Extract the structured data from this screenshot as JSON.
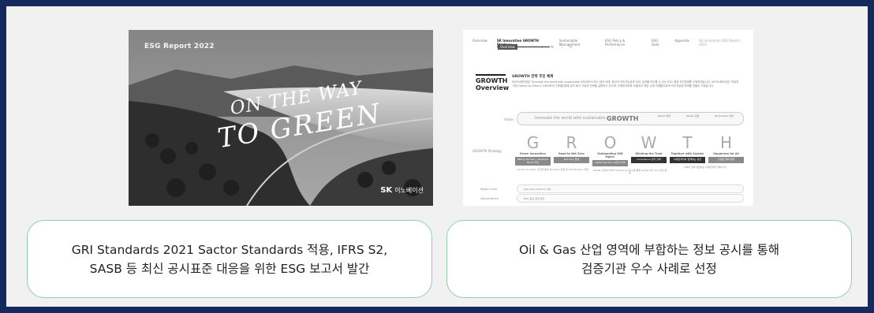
{
  "cover": {
    "label": "ESG Report 2022",
    "title_line1": "ON THE WAY",
    "title_line2": "TO GREEN",
    "logo_mark": "SK",
    "logo_corp": "이노베이션"
  },
  "page": {
    "nav": [
      "Overview",
      "SK Innovation GROWTH Strategy",
      "Sustainable Management",
      "ESG Policy & Performance",
      "ESG Data",
      "Appendix"
    ],
    "nav_right": "SK innovation ESG Report 2022",
    "subtabs": [
      "Overview",
      "G",
      "R",
      "O",
      "W",
      "T",
      "H"
    ],
    "title_line1": "GROWTH",
    "title_line2": "Overview",
    "heading": "GROWTH 전략 추진 체계",
    "description": "SK이노베이션은 'Innovate the world with sustainable GROWTH'라는 비전 아래, 회사의 지속가능성과 ESG 성과를 모두를 수 있는 ESG 경영 추진체계를 수립하였습니다. SK이노베이션은 '카본투 그린(Carbon to Green)' GROWTH 전략을 통해 우리 회사 고유의 전략을 실현하고 있으며, 이해관계자와 소통하고 책임 있게 이행함으로써 지속가능한 미래를 만들어 가겠습니다.",
    "vision_label": "Vision",
    "vision_text": "Innovate the world with sustainable",
    "vision_strong": "GROWTH",
    "vision_sides": [
      "Planet 측면",
      "People 측면",
      "Partnership 측면"
    ],
    "strategy_label": "GROWTH Strategy",
    "letters": [
      {
        "big": "G",
        "cap": "Green Innovation",
        "box": "PBIS & Portfolio / Business Model 혁신",
        "note": "Carbon to Green 추진을 통한 Net Zero 달성 및 Post Bowser 이행"
      },
      {
        "big": "R",
        "cap": "Road to Net Zero",
        "box": "Net Zero 달성",
        "note": ""
      },
      {
        "big": "O",
        "cap": "Outstanding SHE Mgmt.",
        "box": "Global Top Tier 수준의 SHE",
        "note": "Global 수준의 SHE Compliance 준수를 통해 Global Top Tier 안전 확보"
      },
      {
        "big": "W",
        "cap": "Winning the Trust",
        "box": "Compliance 관리 강화",
        "note": ""
      },
      {
        "big": "T",
        "cap": "Together with Society",
        "box": "이해관계자와 함께하는 성장",
        "note": "사회와 함께 성장하는 이해관계자 행복 추구"
      },
      {
        "big": "H",
        "cap": "Happiness for All",
        "box": "구성원 행복 증대",
        "note": ""
      }
    ],
    "mgmt_label": "Mgmt Infra",
    "mgmt_text": "ESG Data Platform 구축",
    "gov_label": "Governance",
    "gov_text": "BOD 중심 경영 실천"
  },
  "captions": {
    "left_line1": "GRI Standards 2021 Sactor Standards 적용, IFRS S2,",
    "left_line2": "SASB 등 최신 공시표준 대응을 위한 ESG 보고서 발간",
    "right_line1": "Oil & Gas 산업 영역에 부합하는 정보 공시를 통해",
    "right_line2": "검증기관 우수 사례로 선정"
  },
  "colors": {
    "background": "#142a5c",
    "stage": "#f1f1f1",
    "caption_border": "#8ed2a3"
  }
}
